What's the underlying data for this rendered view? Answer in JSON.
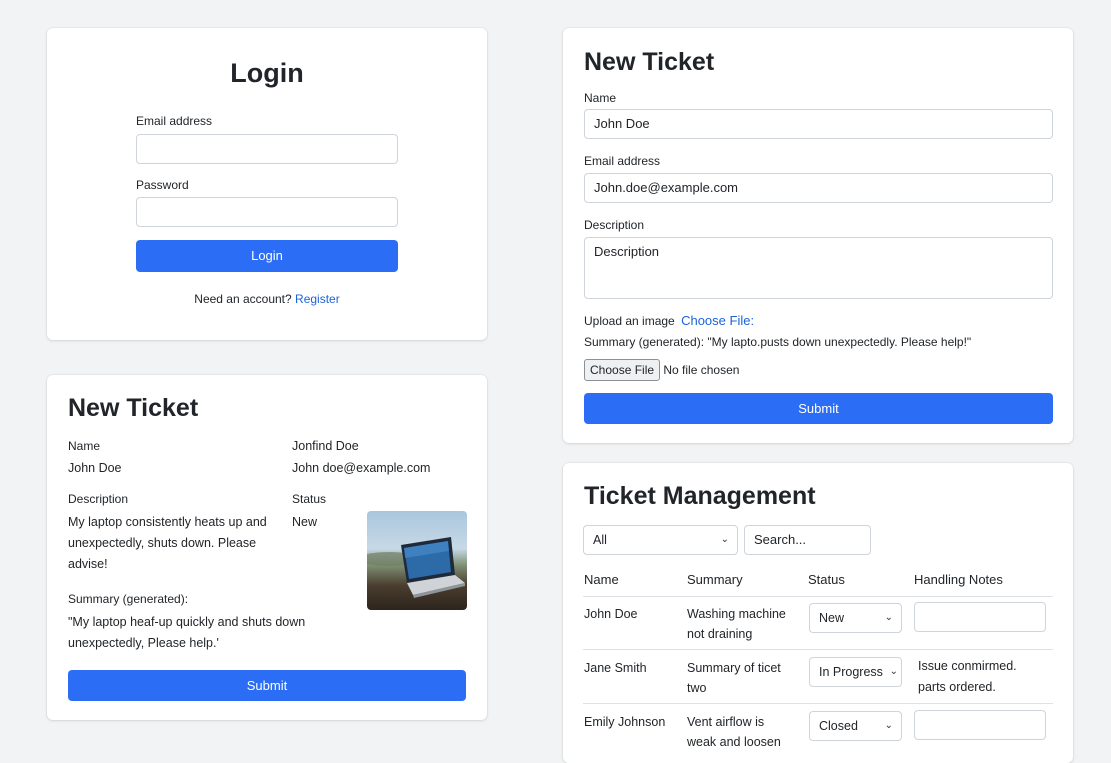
{
  "login": {
    "title": "Login",
    "email_label": "Email address",
    "email_value": "",
    "password_label": "Password",
    "password_value": "",
    "login_button": "Login",
    "need_account_text": "Need an account?",
    "register_link": "Register"
  },
  "ticket_preview": {
    "title": "New Ticket",
    "name_label": "Name",
    "name_value": "John Doe",
    "email_label": "Jonfind Doe",
    "email_value": "John doe@example.com",
    "description_label": "Description",
    "description_value": "My laptop consistently heats up and unexpectedly, shuts down. Please advise!",
    "status_label": "Status",
    "status_value": "New",
    "summary_label": "Summary (generated):",
    "summary_value": "\"My laptop heaf-up quickly and shuts down unexpectedly, Please help.'",
    "submit_button": "Submit"
  },
  "new_ticket_form": {
    "title": "New Ticket",
    "name_label": "Name",
    "name_value": "John Doe",
    "email_label": "Email address",
    "email_value": "John.doe@example.com",
    "description_label": "Description",
    "description_placeholder": "Description",
    "upload_label": "Upload an image",
    "choose_file_link": "Choose File:",
    "summary_prefix": "Summary (generated):",
    "summary_value": "\"My lapto.pusts down unexpectedly. Please help!\"",
    "choose_file_button": "Choose File",
    "no_file_text": "No file chosen",
    "submit_button": "Submit"
  },
  "ticket_management": {
    "title": "Ticket Management",
    "filter_value": "All",
    "search_placeholder": "Search...",
    "columns": [
      "Name",
      "Summary",
      "Status",
      "Handling Notes"
    ],
    "rows": [
      {
        "name": "John Doe",
        "summary_l1": "Washing machine",
        "summary_l2": "not draining",
        "status": "New",
        "notes_l1": "",
        "notes_l2": ""
      },
      {
        "name": "Jane Smith",
        "summary_l1": "Summary of ticet",
        "summary_l2": "two",
        "status": "In Progress",
        "notes_l1": "Issue conmirmed.",
        "notes_l2": "parts ordered."
      },
      {
        "name": "Emily Johnson",
        "summary_l1": "Vent airflow is",
        "summary_l2": "weak and loosen",
        "status": "Closed",
        "notes_l1": "",
        "notes_l2": ""
      }
    ]
  },
  "colors": {
    "primary": "#2b6ef5",
    "link": "#1d63d8",
    "background": "#f1f3f5"
  }
}
